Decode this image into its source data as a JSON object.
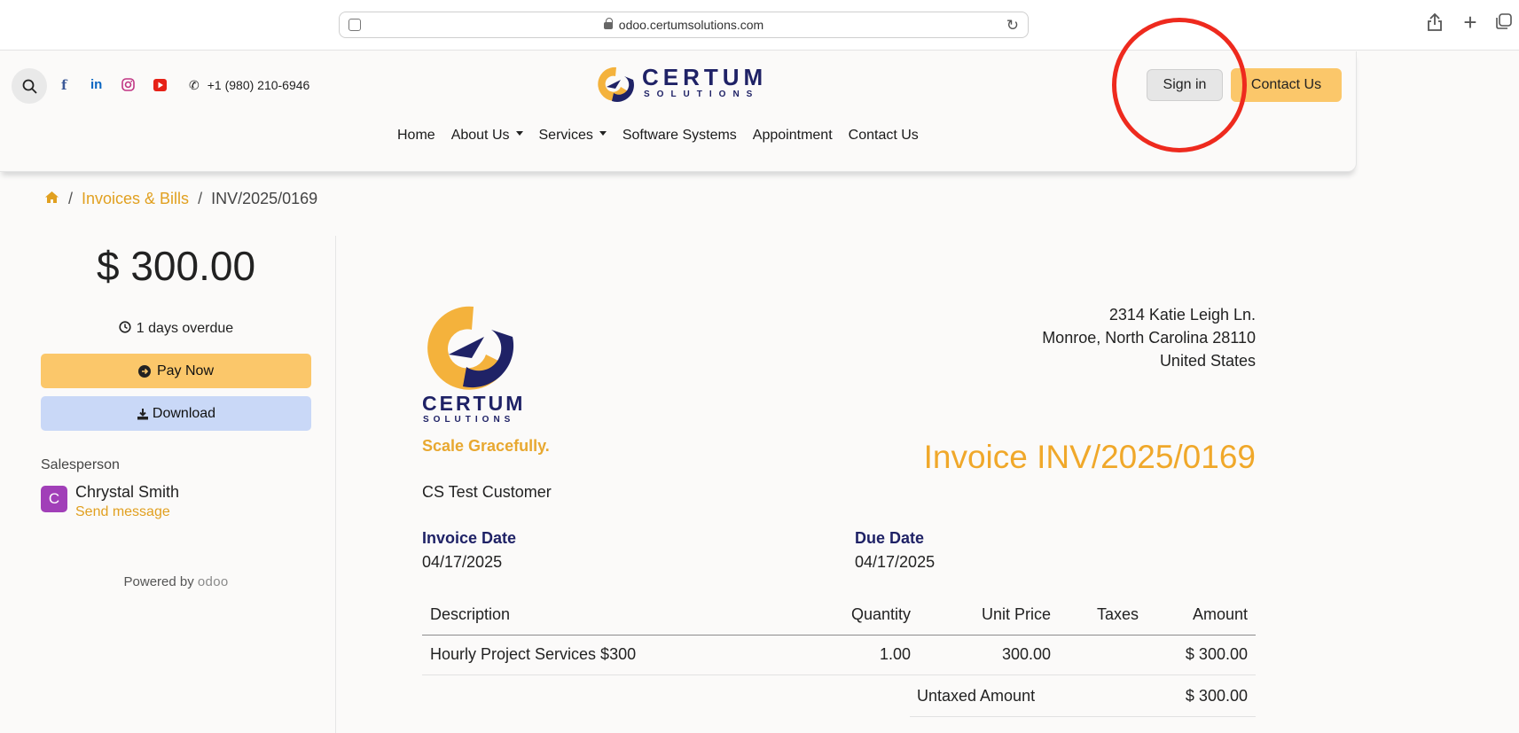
{
  "browser": {
    "url": "odoo.certumsolutions.com"
  },
  "header": {
    "phone": "+1 (980) 210-6946",
    "logo": {
      "word": "CERTUM",
      "sub": "SOLUTIONS"
    },
    "signin_label": "Sign in",
    "contact_label": "Contact Us",
    "nav": [
      {
        "label": "Home",
        "dropdown": false
      },
      {
        "label": "About Us",
        "dropdown": true
      },
      {
        "label": "Services",
        "dropdown": true
      },
      {
        "label": "Software Systems",
        "dropdown": false
      },
      {
        "label": "Appointment",
        "dropdown": false
      },
      {
        "label": "Contact Us",
        "dropdown": false
      }
    ],
    "social": [
      "facebook-icon",
      "linkedin-icon",
      "instagram-icon",
      "youtube-icon"
    ]
  },
  "breadcrumb": {
    "link": "Invoices & Bills",
    "current": "INV/2025/0169"
  },
  "sidebar": {
    "amount": "$ 300.00",
    "overdue": "1 days overdue",
    "pay_label": "Pay Now",
    "download_label": "Download",
    "salesperson_label": "Salesperson",
    "avatar_letter": "C",
    "salesperson_name": "Chrystal Smith",
    "send_message": "Send message",
    "powered_by": "Powered by",
    "odoo": "odoo"
  },
  "invoice": {
    "logo": {
      "word": "CERTUM",
      "sub": "SOLUTIONS"
    },
    "tagline": "Scale Gracefully.",
    "address": [
      "2314 Katie Leigh Ln.",
      "Monroe, North Carolina 28110",
      "United States"
    ],
    "title": "Invoice INV/2025/0169",
    "customer": "CS Test Customer",
    "invoice_date_label": "Invoice Date",
    "invoice_date": "04/17/2025",
    "due_date_label": "Due Date",
    "due_date": "04/17/2025",
    "columns": [
      "Description",
      "Quantity",
      "Unit Price",
      "Taxes",
      "Amount"
    ],
    "lines": [
      {
        "description": "Hourly Project Services $300",
        "quantity": "1.00",
        "unit_price": "300.00",
        "taxes": "",
        "amount": "$ 300.00"
      }
    ],
    "untaxed_label": "Untaxed Amount",
    "untaxed_value": "$ 300.00"
  },
  "colors": {
    "accent": "#fbc76a",
    "link": "#e1a020",
    "navy": "#1f2266",
    "title": "#f0a82a",
    "annotation": "#ee2a1e"
  }
}
